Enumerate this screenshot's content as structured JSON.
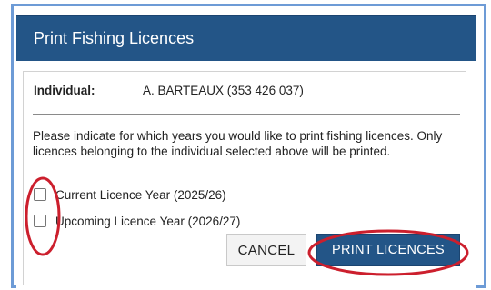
{
  "dialog": {
    "title": "Print Fishing Licences",
    "individual_label": "Individual:",
    "individual_value": "A. BARTEAUX (353 426 037)",
    "instructions": "Please indicate for which years you would like to print fishing licences. Only licences belonging to the individual selected above will be printed.",
    "options": [
      {
        "label": "Current Licence Year (2025/26)",
        "checked": false
      },
      {
        "label": "Upcoming Licence Year (2026/27)",
        "checked": false
      }
    ],
    "cancel_label": "CANCEL",
    "print_label": "PRINT LICENCES"
  },
  "colors": {
    "header": "#235587",
    "primary_button": "#235587",
    "frame_border": "#6d9bd6",
    "annotation": "#cc1f2d"
  }
}
